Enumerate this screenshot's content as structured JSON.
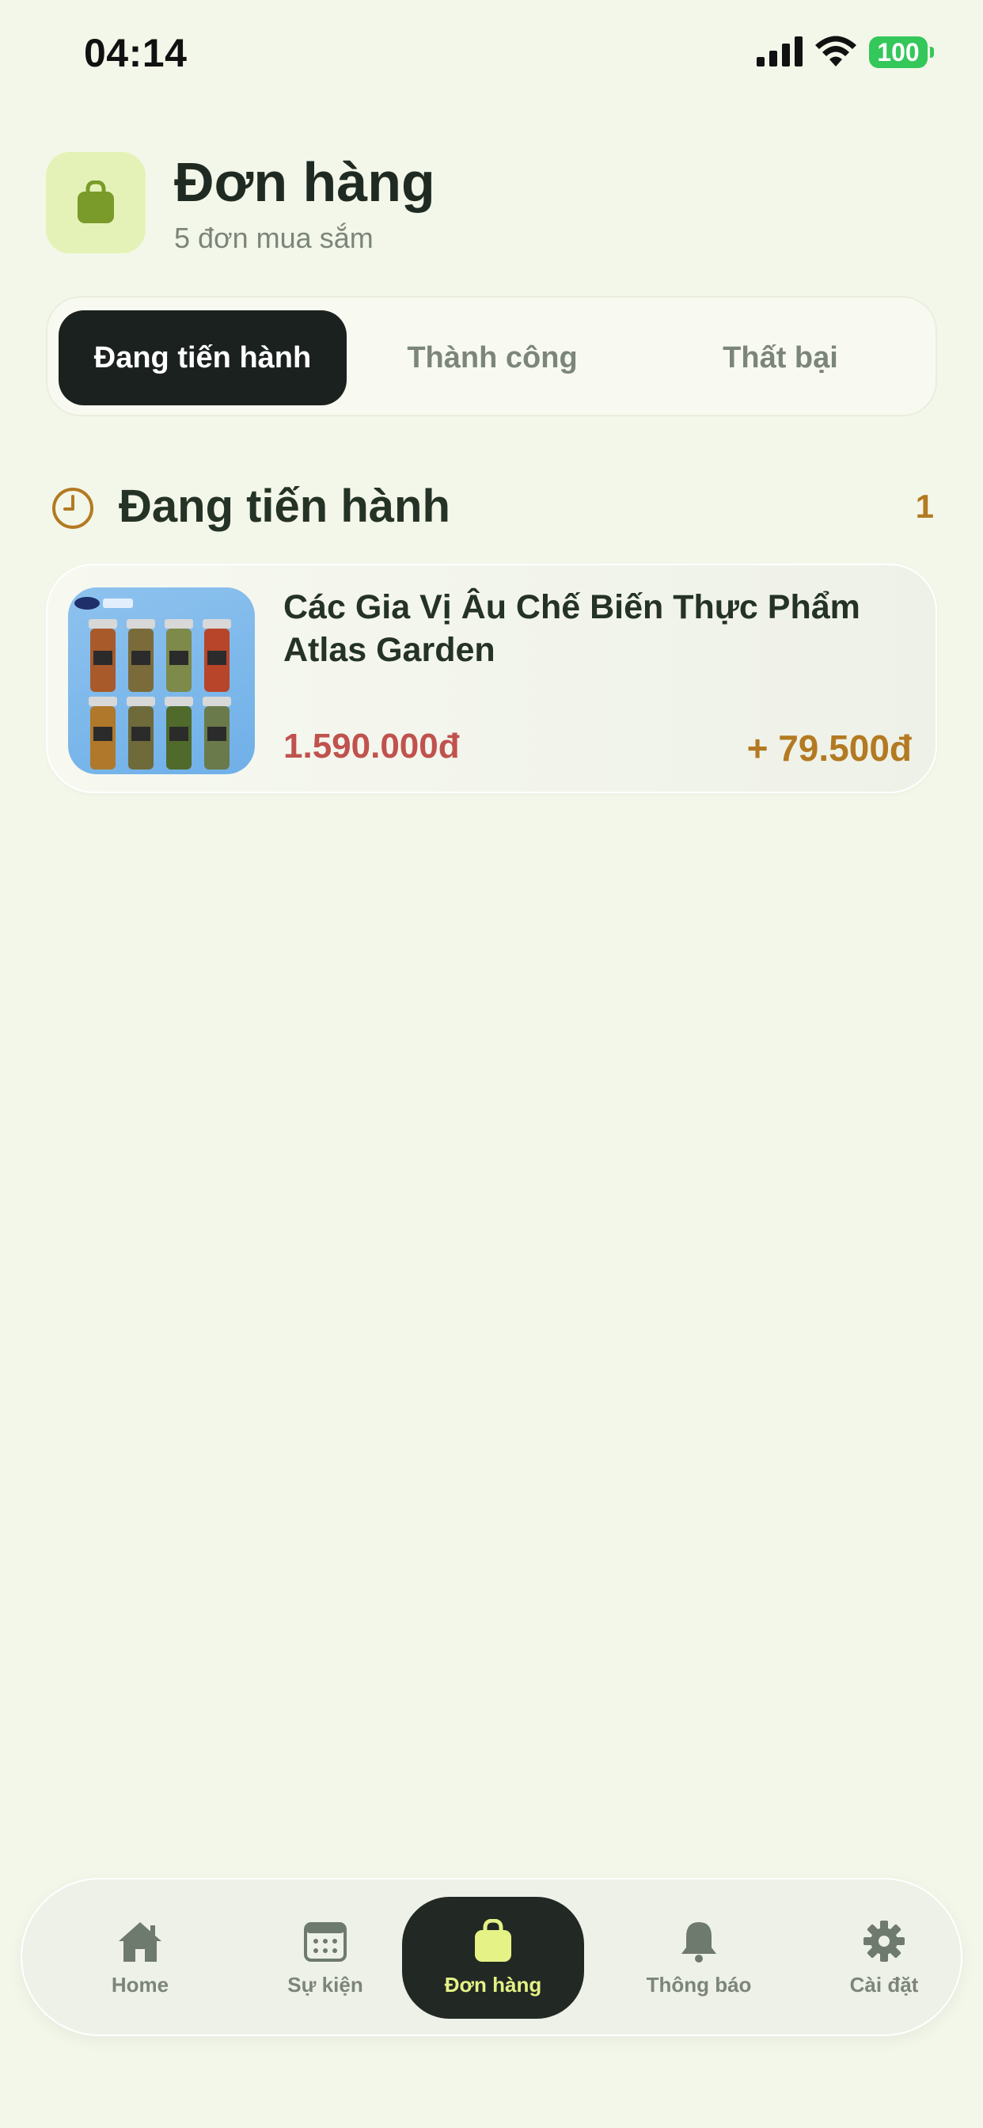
{
  "status_bar": {
    "time": "04:14",
    "battery": "100"
  },
  "header": {
    "title": "Đơn hàng",
    "subtitle": "5 đơn mua sắm",
    "icon": "shopping-bag-icon"
  },
  "tabs": [
    {
      "label": "Đang tiến hành",
      "active": true
    },
    {
      "label": "Thành công",
      "active": false
    },
    {
      "label": "Thất bại",
      "active": false
    }
  ],
  "section": {
    "title": "Đang tiến hành",
    "count": "1",
    "icon": "clock-icon"
  },
  "orders": [
    {
      "name": "Các Gia Vị Âu Chế Biến Thực Phẩm Atlas Garden",
      "price": "1.590.000đ",
      "reward": "+ 79.500đ"
    }
  ],
  "bottom_nav": [
    {
      "label": "Home",
      "icon": "home-icon",
      "active": false
    },
    {
      "label": "Sự kiện",
      "icon": "calendar-icon",
      "active": false
    },
    {
      "label": "Đơn hàng",
      "icon": "shopping-bag-icon",
      "active": true
    },
    {
      "label": "Thông báo",
      "icon": "bell-icon",
      "active": false
    },
    {
      "label": "Cài đặt",
      "icon": "gear-icon",
      "active": false
    }
  ],
  "colors": {
    "background": "#f3f7e9",
    "accent": "#e4f2b8",
    "dark": "#1b211e",
    "price": "#c0524e",
    "reward": "#b37a22"
  }
}
